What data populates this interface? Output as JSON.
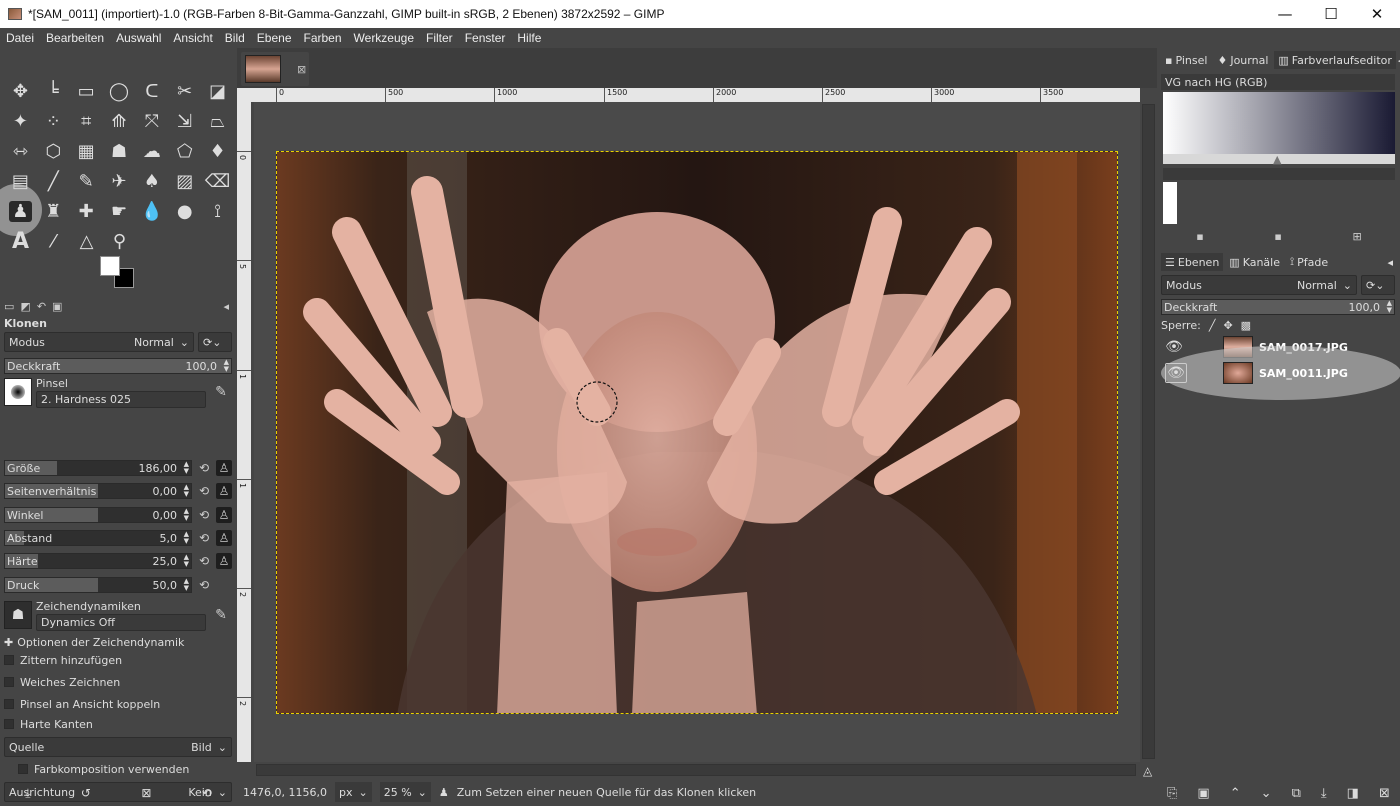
{
  "window": {
    "title": "*[SAM_0011] (importiert)-1.0 (RGB-Farben 8-Bit-Gamma-Ganzzahl, GIMP built-in sRGB, 2 Ebenen) 3872x2592 – GIMP",
    "minimize": "—",
    "maximize": "☐",
    "close": "✕"
  },
  "menu": [
    "Datei",
    "Bearbeiten",
    "Auswahl",
    "Ansicht",
    "Bild",
    "Ebene",
    "Farben",
    "Werkzeuge",
    "Filter",
    "Fenster",
    "Hilfe"
  ],
  "tool_options": {
    "title": "Klonen",
    "mode_label": "Modus",
    "mode_value": "Normal",
    "opacity_label": "Deckkraft",
    "opacity_value": "100,0",
    "brush_label": "Pinsel",
    "brush_value": "2. Hardness 025",
    "sliders": [
      {
        "label": "Größe",
        "value": "186,00",
        "fill": 0.28
      },
      {
        "label": "Seitenverhältnis",
        "value": "0,00",
        "fill": 0.5
      },
      {
        "label": "Winkel",
        "value": "0,00",
        "fill": 0.5
      },
      {
        "label": "Abstand",
        "value": "5,0",
        "fill": 0.1
      },
      {
        "label": "Härte",
        "value": "25,0",
        "fill": 0.18
      },
      {
        "label": "Druck",
        "value": "50,0",
        "fill": 0.5
      }
    ],
    "dynamics_label": "Zeichendynamiken",
    "dynamics_value": "Dynamics Off",
    "dynamics_options": "Optionen der Zeichendynamik",
    "checkboxes": [
      "Zittern hinzufügen",
      "Weiches Zeichnen",
      "Pinsel an Ansicht koppeln",
      "Harte Kanten"
    ],
    "source_label": "Quelle",
    "source_value": "Bild",
    "sample_merged": "Farbkomposition verwenden",
    "alignment_label": "Ausrichtung",
    "alignment_value": "Kein"
  },
  "ruler": {
    "h_ticks": [
      "0",
      "500",
      "1000",
      "1500",
      "2000",
      "2500",
      "3000",
      "3500"
    ],
    "v_ticks": [
      "0",
      "5",
      "1",
      "1",
      "2",
      "2"
    ]
  },
  "status": {
    "coords": "1476,0, 1156,0",
    "unit": "px",
    "zoom": "25 %",
    "message": "Zum Setzen einer neuen Quelle für das Klonen klicken"
  },
  "gradient_dock": {
    "tabs": [
      "Pinsel",
      "Journal",
      "Farbverlaufseditor"
    ],
    "gradient_name": "VG nach HG (RGB)"
  },
  "layers_dock": {
    "tabs": [
      "Ebenen",
      "Kanäle",
      "Pfade"
    ],
    "mode_label": "Modus",
    "mode_value": "Normal",
    "opacity_label": "Deckkraft",
    "opacity_value": "100,0",
    "lock_label": "Sperre:",
    "layers": [
      {
        "name": "SAM_0017.JPG",
        "selected": false
      },
      {
        "name": "SAM_0011.JPG",
        "selected": true
      }
    ]
  },
  "colors": {
    "accent": "#e8d200",
    "bg": "#454545"
  }
}
